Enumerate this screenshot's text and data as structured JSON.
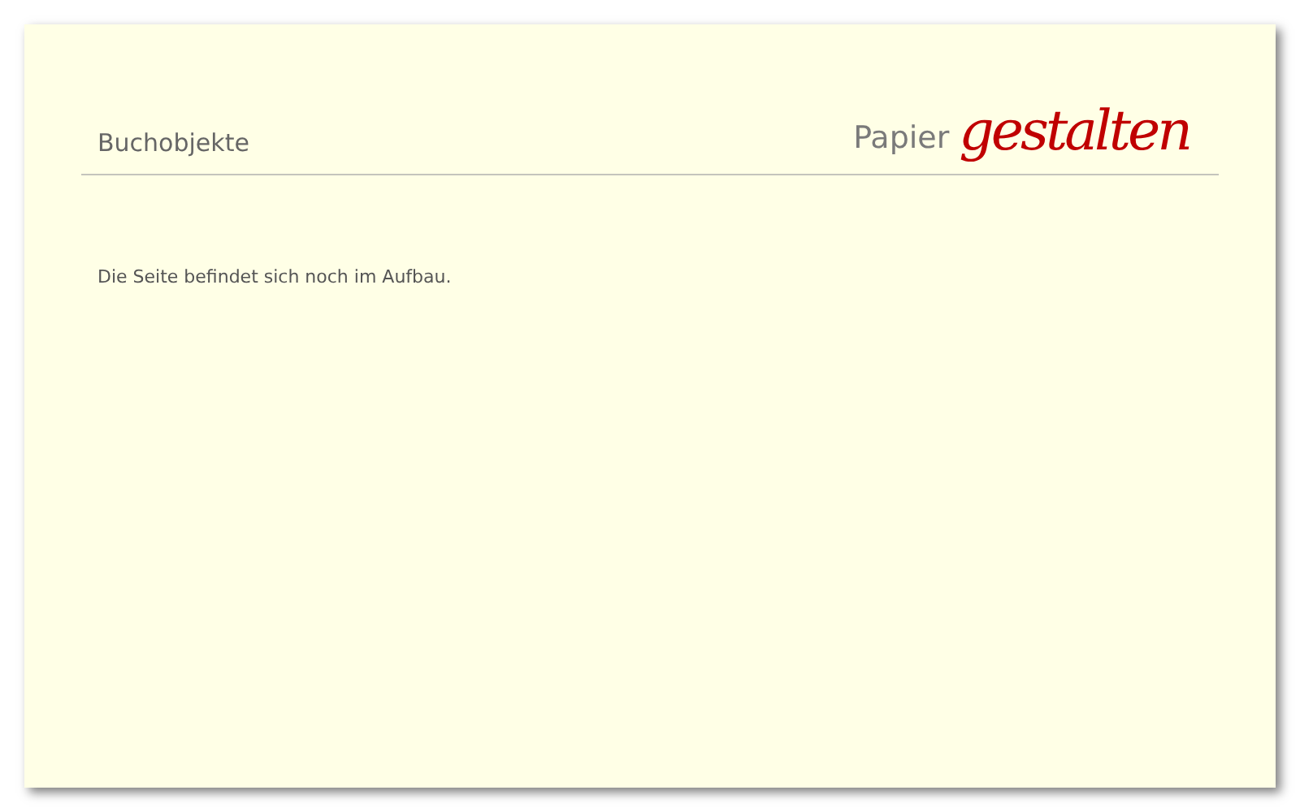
{
  "page_title": "Buchobjekte",
  "logo": {
    "word_1": "Papier",
    "word_2": "gestalten"
  },
  "body_text": "Die Seite befindet sich noch im Aufbau."
}
